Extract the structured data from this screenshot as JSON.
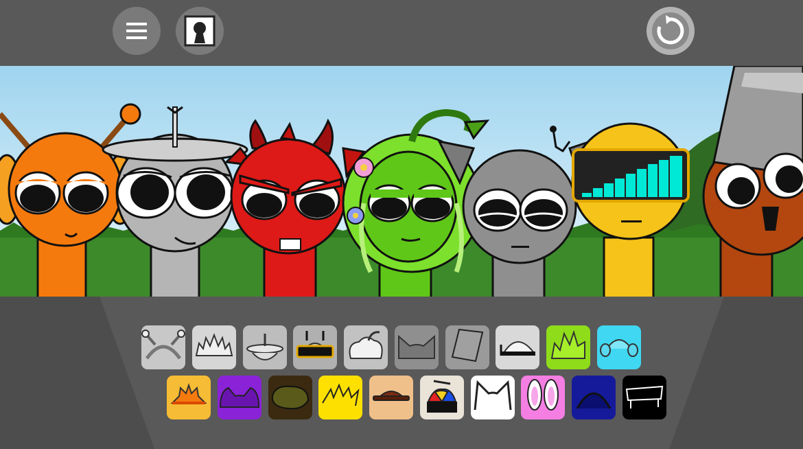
{
  "toolbar": {
    "menu_icon": "hamburger-menu-icon",
    "keyhole_icon": "keyhole-icon",
    "reset_icon": "circular-arrow-reset-icon"
  },
  "colors": {
    "background": "#595959",
    "button": "#7a7a7a",
    "sky_top": "#9fd4ef",
    "grass": "#3d8a2b",
    "orange": "#f57a0d",
    "silver": "#b5b5b5",
    "red": "#dd1a17",
    "green": "#5fc718",
    "gray": "#8f8f8f",
    "yellow": "#f5c319",
    "brown": "#b3470f"
  },
  "characters": [
    {
      "id": "orange-headphones",
      "color": "#f57a0d"
    },
    {
      "id": "silver-antenna-dish",
      "color": "#b5b5b5"
    },
    {
      "id": "red-devil",
      "color": "#dd1a17"
    },
    {
      "id": "green-plant-hair",
      "color": "#5fc718"
    },
    {
      "id": "gray-cat",
      "color": "#8f8f8f"
    },
    {
      "id": "yellow-visor",
      "color": "#f5c319"
    },
    {
      "id": "brown-bucket",
      "color": "#b3470f"
    }
  ],
  "palette_row1": [
    {
      "name": "headphones-antenna",
      "bg": "#c8c8c8"
    },
    {
      "name": "spiky-hair",
      "bg": "#d6d6d6"
    },
    {
      "name": "antenna-dish",
      "bg": "#bdbdbd"
    },
    {
      "name": "black-visor-helmet",
      "bg": "#b0b0b0"
    },
    {
      "name": "bomb-hair",
      "bg": "#c2c2c2"
    },
    {
      "name": "cat-ears",
      "bg": "#8f8f8f"
    },
    {
      "name": "bucket",
      "bg": "#9a9a9a"
    },
    {
      "name": "dome-helmet",
      "bg": "#d9d9d9"
    },
    {
      "name": "green-spiky-hair",
      "bg": "#8fdc1a"
    },
    {
      "name": "cyan-earmuffs",
      "bg": "#3fd7f2"
    }
  ],
  "palette_row2": [
    {
      "name": "sun-crown",
      "bg": "#f7bc36"
    },
    {
      "name": "purple-horns",
      "bg": "#8a22d8"
    },
    {
      "name": "brown-blob",
      "bg": "#3b2a10"
    },
    {
      "name": "yellow-lightning",
      "bg": "#fde000"
    },
    {
      "name": "brown-hat",
      "bg": "#efc08a"
    },
    {
      "name": "propeller-cap",
      "bg": "#e9e3d8"
    },
    {
      "name": "white-cat-ears",
      "bg": "#ffffff"
    },
    {
      "name": "pink-bunny-ears",
      "bg": "#f57ee3"
    },
    {
      "name": "navy-dome",
      "bg": "#151a9a"
    },
    {
      "name": "black-frame",
      "bg": "#000000"
    }
  ]
}
